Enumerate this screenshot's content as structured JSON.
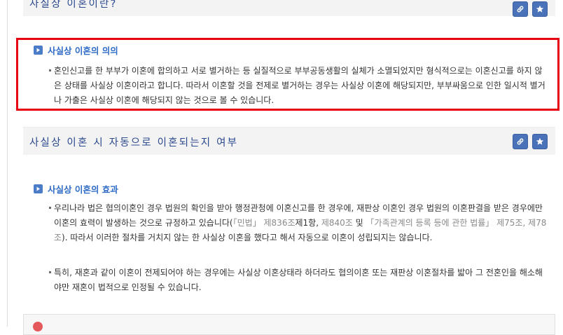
{
  "section_top": {
    "title": "사실상 이혼이란?"
  },
  "meaning": {
    "heading": "사실상 이혼의 의의",
    "paragraph": "혼인신고를 한 부부가 이혼에 합의하고 서로 별거하는 등 실질적으로 부부공동생활의 실체가 소멸되었지만 형식적으로는 이혼신고를 하지 않은 상태를 사실상 이혼이라고 합니다. 따라서 이혼할 것을 전제로 별거하는 경우는 사실상 이혼에 해당되지만, 부부싸움으로 인한 일시적 별거나 가출은 사실상 이혼에 해당되지 않는 것으로 볼 수 있습니다."
  },
  "section_auto": {
    "title": "사실상 이혼 시 자동으로 이혼되는지 여부"
  },
  "effect": {
    "heading": "사실상 이혼의 효과",
    "para1_a": "우리나라 법은 협의이혼인 경우 법원의 확인을 받아 행정관청에 이혼신고를 한 경우에, 재판상 이혼인 경우 법원의 이혼판결을 받은 경우에만 이혼의 효력이 발생하는 것으로 규정하고 있습니다(",
    "law1": "「민법」 제836조",
    "para1_b": "제1항, ",
    "law2": "제840조",
    "para1_c": " 및 ",
    "law3": "「가족관계의 등록 등에 관한 법률」 제75조, 제78조",
    "para1_d": "). 따라서 이러한 절차를 거치지 않는 한 사실상 이혼을 했다고 해서 자동으로 이혼이 성립되지는 않습니다.",
    "para2": "특히, 재혼과 같이 이혼이 전제되어야 하는 경우에는 사실상 이혼상태라 하더라도 협의이혼 또는 재판상 이혼절차를 밟아 그 전혼인을 해소해야만 재혼이 법적으로 인정될 수 있습니다."
  },
  "icons": {
    "link": "link-icon",
    "bookmark": "star-icon"
  },
  "colors": {
    "heading_blue": "#2e6bc6",
    "title_blue": "#2c4a8f",
    "button_blue": "#4a72b8",
    "highlight_red": "#e60012"
  }
}
